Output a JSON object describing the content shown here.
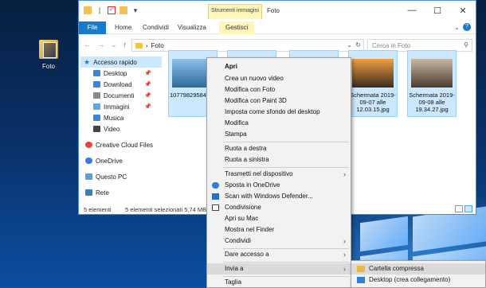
{
  "desktop": {
    "icon_label": "Foto"
  },
  "window": {
    "title": "Foto",
    "tool_tab": "Strumenti immagini",
    "ribbon_tabs": {
      "file": "File",
      "home": "Home",
      "share": "Condividi",
      "view": "Visualizza",
      "manage": "Gestisci"
    },
    "controls": {
      "minimize": "—",
      "maximize": "☐",
      "close": "✕"
    }
  },
  "address": {
    "path": "Foto",
    "search_placeholder": "Cerca in Foto"
  },
  "nav_pane": {
    "quick_access": "Accesso rapido",
    "items": [
      {
        "label": "Desktop",
        "pinned": true,
        "color": "#3a86d4"
      },
      {
        "label": "Download",
        "pinned": true,
        "color": "#3a86d4"
      },
      {
        "label": "Documenti",
        "pinned": true,
        "color": "#8a8a8a"
      },
      {
        "label": "Immagini",
        "pinned": true,
        "color": "#5fa8e0"
      },
      {
        "label": "Musica",
        "pinned": false,
        "color": "#3a86d4"
      },
      {
        "label": "Video",
        "pinned": false,
        "color": "#444"
      }
    ],
    "creative_cloud": "Creative Cloud Files",
    "onedrive": "OneDrive",
    "this_pc": "Questo PC",
    "network": "Rete"
  },
  "files": [
    {
      "name": "10779829584_G_1711.jpeg",
      "colors": [
        "#8cc0e8",
        "#2f6a9a"
      ]
    },
    {
      "name": "",
      "colors": [
        "#6fa7d6",
        "#1f4f7a"
      ]
    },
    {
      "name": "",
      "colors": [
        "#7db3e0",
        "#f0f4f8"
      ]
    },
    {
      "name": "Schermata 2019-09-07 alle 12.03.15.jpg",
      "colors": [
        "#f0a040",
        "#3a2a20"
      ]
    },
    {
      "name": "Schermata 2019-09-08 alle 19.34.27.jpg",
      "colors": [
        "#c8b8a0",
        "#4a3a30"
      ]
    }
  ],
  "status": {
    "count": "5 elementi",
    "selected": "5 elementi selezionati  5,74 MB"
  },
  "context_menu": {
    "items": [
      {
        "label": "Apri",
        "bold": true
      },
      {
        "label": "Crea un nuovo video"
      },
      {
        "label": "Modifica con Foto"
      },
      {
        "label": "Modifica con Paint 3D"
      },
      {
        "label": "Imposta come sfondo del desktop"
      },
      {
        "label": "Modifica"
      },
      {
        "label": "Stampa"
      },
      {
        "sep": true
      },
      {
        "label": "Ruota a destra"
      },
      {
        "label": "Ruota a sinistra"
      },
      {
        "sep": true
      },
      {
        "label": "Trasmetti nel dispositivo",
        "submenu": true
      },
      {
        "label": "Sposta in OneDrive",
        "icon": "onedrive-icon"
      },
      {
        "label": "Scan with Windows Defender...",
        "icon": "defender-icon"
      },
      {
        "label": "Condivisione",
        "icon": "share-icon"
      },
      {
        "label": "Apri su Mac"
      },
      {
        "label": "Mostra nel Finder"
      },
      {
        "label": "Condividi",
        "submenu": true
      },
      {
        "sep": true
      },
      {
        "label": "Dare accesso a",
        "submenu": true
      },
      {
        "sep": true
      },
      {
        "label": "Invia a",
        "submenu": true,
        "highlighted": true
      },
      {
        "sep": true
      },
      {
        "label": "Taglia"
      }
    ]
  },
  "send_to": {
    "items": [
      {
        "label": "Cartella compressa",
        "icon": "zip-folder-icon",
        "highlighted": true
      },
      {
        "label": "Desktop (crea collegamento)",
        "icon": "desktop-icon"
      }
    ]
  }
}
